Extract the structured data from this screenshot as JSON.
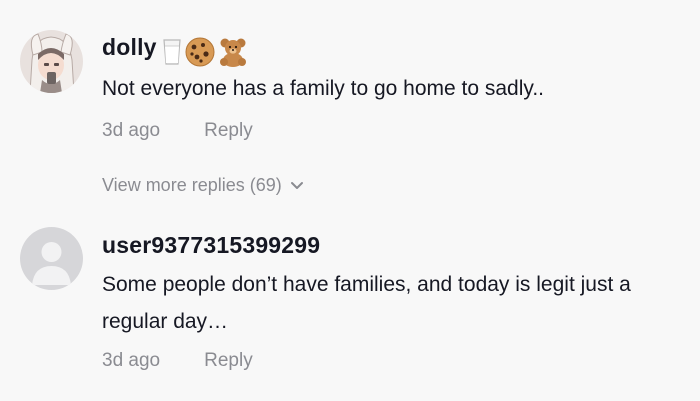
{
  "comments": [
    {
      "username": "dolly",
      "emoji_icons": [
        "milk-glass-icon",
        "cookie-icon",
        "teddy-bear-icon"
      ],
      "text": "Not everyone has a family to go home to sadly..",
      "time": "3d ago",
      "reply_label": "Reply",
      "view_more": "View more replies (69)"
    },
    {
      "username": "user9377315399299",
      "text": "Some people don’t have families, and today is legit just a regular day…",
      "time": "3d ago",
      "reply_label": "Reply"
    }
  ],
  "colors": {
    "background": "#f8f8f8",
    "primary_text": "#161823",
    "secondary_text": "#8a8b91"
  }
}
